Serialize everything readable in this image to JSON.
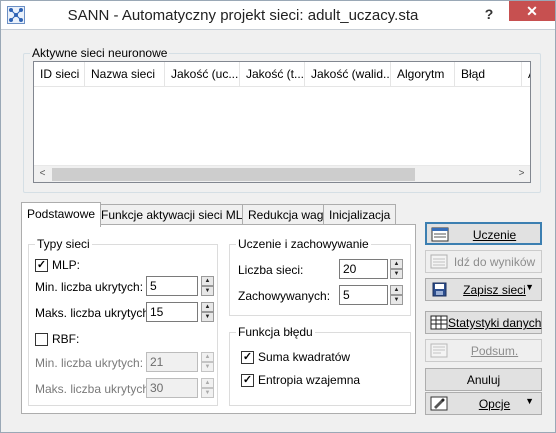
{
  "window": {
    "title": "SANN - Automatyczny projekt sieci: adult_uczacy.sta",
    "help_label": "?",
    "close_label": "✕"
  },
  "active_networks": {
    "group_label": "Aktywne sieci neuronowe",
    "columns": [
      "ID sieci",
      "Nazwa sieci",
      "Jakość (uc...",
      "Jakość (t...",
      "Jakość (walid...",
      "Algorytm",
      "Błąd",
      "A"
    ],
    "rows": [],
    "scroll_left_icon": "<",
    "scroll_right_icon": ">"
  },
  "tabs": [
    {
      "label": "Podstawowe",
      "active": true
    },
    {
      "label": "Funkcje aktywacji sieci MLP",
      "active": false
    },
    {
      "label": "Redukcja wag",
      "active": false
    },
    {
      "label": "Inicjalizacja",
      "active": false
    }
  ],
  "network_types": {
    "group_label": "Typy sieci",
    "mlp": {
      "label": "MLP:",
      "checked": true,
      "min_hidden_label": "Min. liczba ukrytych:",
      "min_hidden_value": "5",
      "max_hidden_label": "Maks. liczba ukrytych:",
      "max_hidden_value": "15"
    },
    "rbf": {
      "label": "RBF:",
      "checked": false,
      "min_hidden_label": "Min. liczba ukrytych:",
      "min_hidden_value": "21",
      "max_hidden_label": "Maks. liczba ukrytych:",
      "max_hidden_value": "30"
    }
  },
  "training": {
    "group_label": "Uczenie i zachowywanie",
    "networks_label": "Liczba sieci:",
    "networks_value": "20",
    "retained_label": "Zachowywanych:",
    "retained_value": "5"
  },
  "error_function": {
    "group_label": "Funkcja błędu",
    "sum_squares_label": "Suma kwadratów",
    "sum_squares_checked": true,
    "entropy_label": "Entropia wzajemna",
    "entropy_checked": true
  },
  "buttons": {
    "train": "Uczenie",
    "go_to_results": "Idź do wyników",
    "save_networks": "Zapisz sieci",
    "data_statistics": "Statystyki danych",
    "summary": "Podsum.",
    "cancel": "Anuluj",
    "options": "Opcje"
  },
  "spin_up_glyph": "▲",
  "spin_down_glyph": "▼",
  "dropdown_glyph": "▼",
  "check_glyph": "✓"
}
